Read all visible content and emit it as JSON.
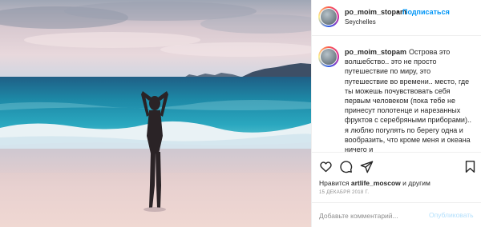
{
  "post": {
    "username": "po_moim_stopam",
    "header_separator": "•",
    "follow_label": "Подписаться",
    "location": "Seychelles",
    "caption": "Острова это волшебство.. это не просто путешествие по миру, это путешествие во времени.. место, где ты можешь почувствовать себя первым человеком (пока тебе не принесут полотенце и нарезанных фруктов с серебряными приборами).. я люблю погулять по берегу одна и вообразить, что кроме меня и океана ничего и",
    "likes_prefix": "Нравится",
    "likes_user": "artlife_moscow",
    "likes_suffix": "и другим",
    "date": "15 ДЕКАБРЯ 2018 Г.",
    "comment_placeholder": "Добавьте комментарий...",
    "publish_label": "Опубликовать"
  },
  "icons": {
    "like": "heart-icon",
    "comment": "comment-bubble-icon",
    "share": "paper-plane-icon",
    "save": "bookmark-icon"
  },
  "colors": {
    "link_blue": "#0095f6",
    "publish_disabled": "#b2dffc",
    "muted": "#8e8e8e",
    "text": "#262626"
  }
}
